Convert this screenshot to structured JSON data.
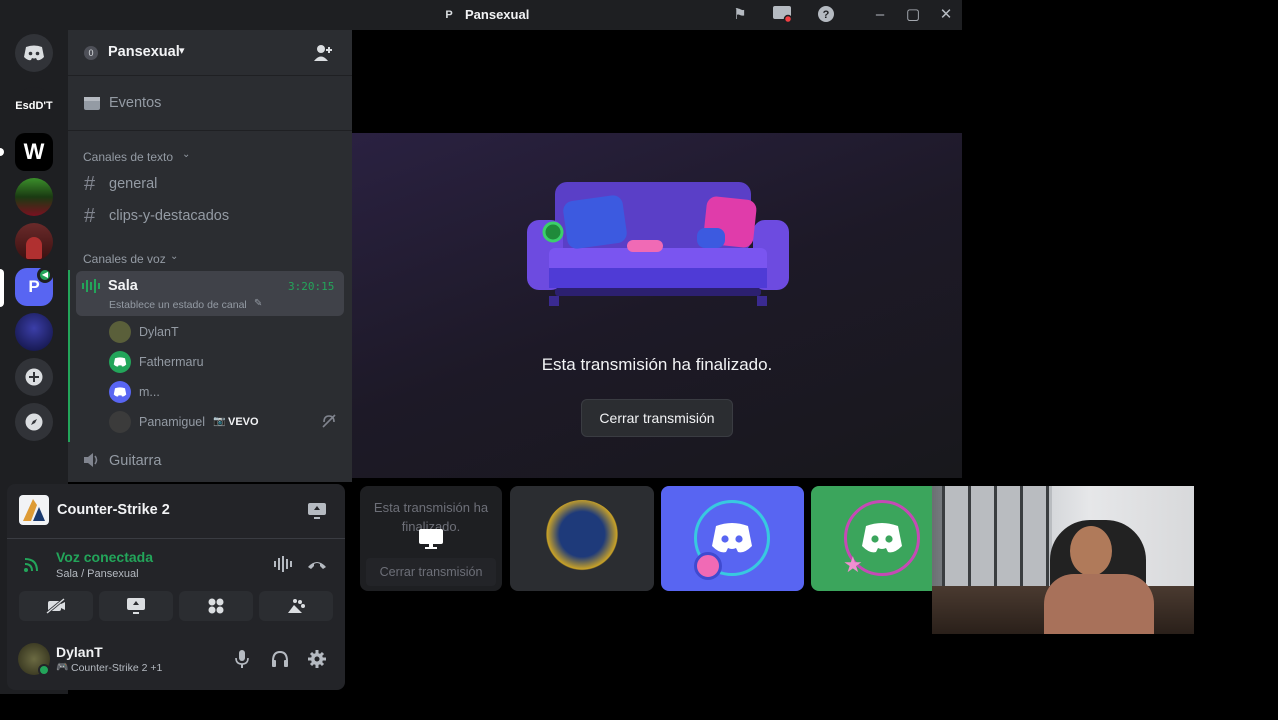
{
  "titlebar": {
    "logo_letter": "P",
    "title": "Pansexual"
  },
  "rail": {
    "server_esd": "EsdD'T",
    "server_w": "W",
    "server_p": "P"
  },
  "server": {
    "badge": "0",
    "name": "Pansexual"
  },
  "events": {
    "label": "Eventos"
  },
  "text_section": {
    "label": "Canales de texto"
  },
  "text_channels": [
    "general",
    "clips-y-destacados"
  ],
  "voice_section": {
    "label": "Canales de voz"
  },
  "voice_channel": {
    "name": "Sala",
    "timer": "3:20:15",
    "status": "Establece un estado de canal"
  },
  "voice_users": [
    {
      "name": "DylanT"
    },
    {
      "name": "Fathermaru"
    },
    {
      "name": "m..."
    },
    {
      "name": "Panamiguel",
      "tag": "VEVO"
    }
  ],
  "voice_channel_2": {
    "name": "Guitarra"
  },
  "activity": {
    "game": "Counter-Strike 2"
  },
  "voice_status": {
    "label": "Voz conectada",
    "location": "Sala / Pansexual"
  },
  "user": {
    "name": "DylanT",
    "activity": "Counter-Strike 2 +1"
  },
  "stage": {
    "ended_text": "Esta transmisión ha finalizado.",
    "close_label": "Cerrar transmisión"
  },
  "tiles": {
    "mini_ended": "Esta transmisión ha finalizado.",
    "mini_close": "Cerrar transmisión"
  },
  "colors": {
    "green": "#23a55a",
    "blurple": "#5865f2",
    "accent_green": "#3ba55c"
  }
}
